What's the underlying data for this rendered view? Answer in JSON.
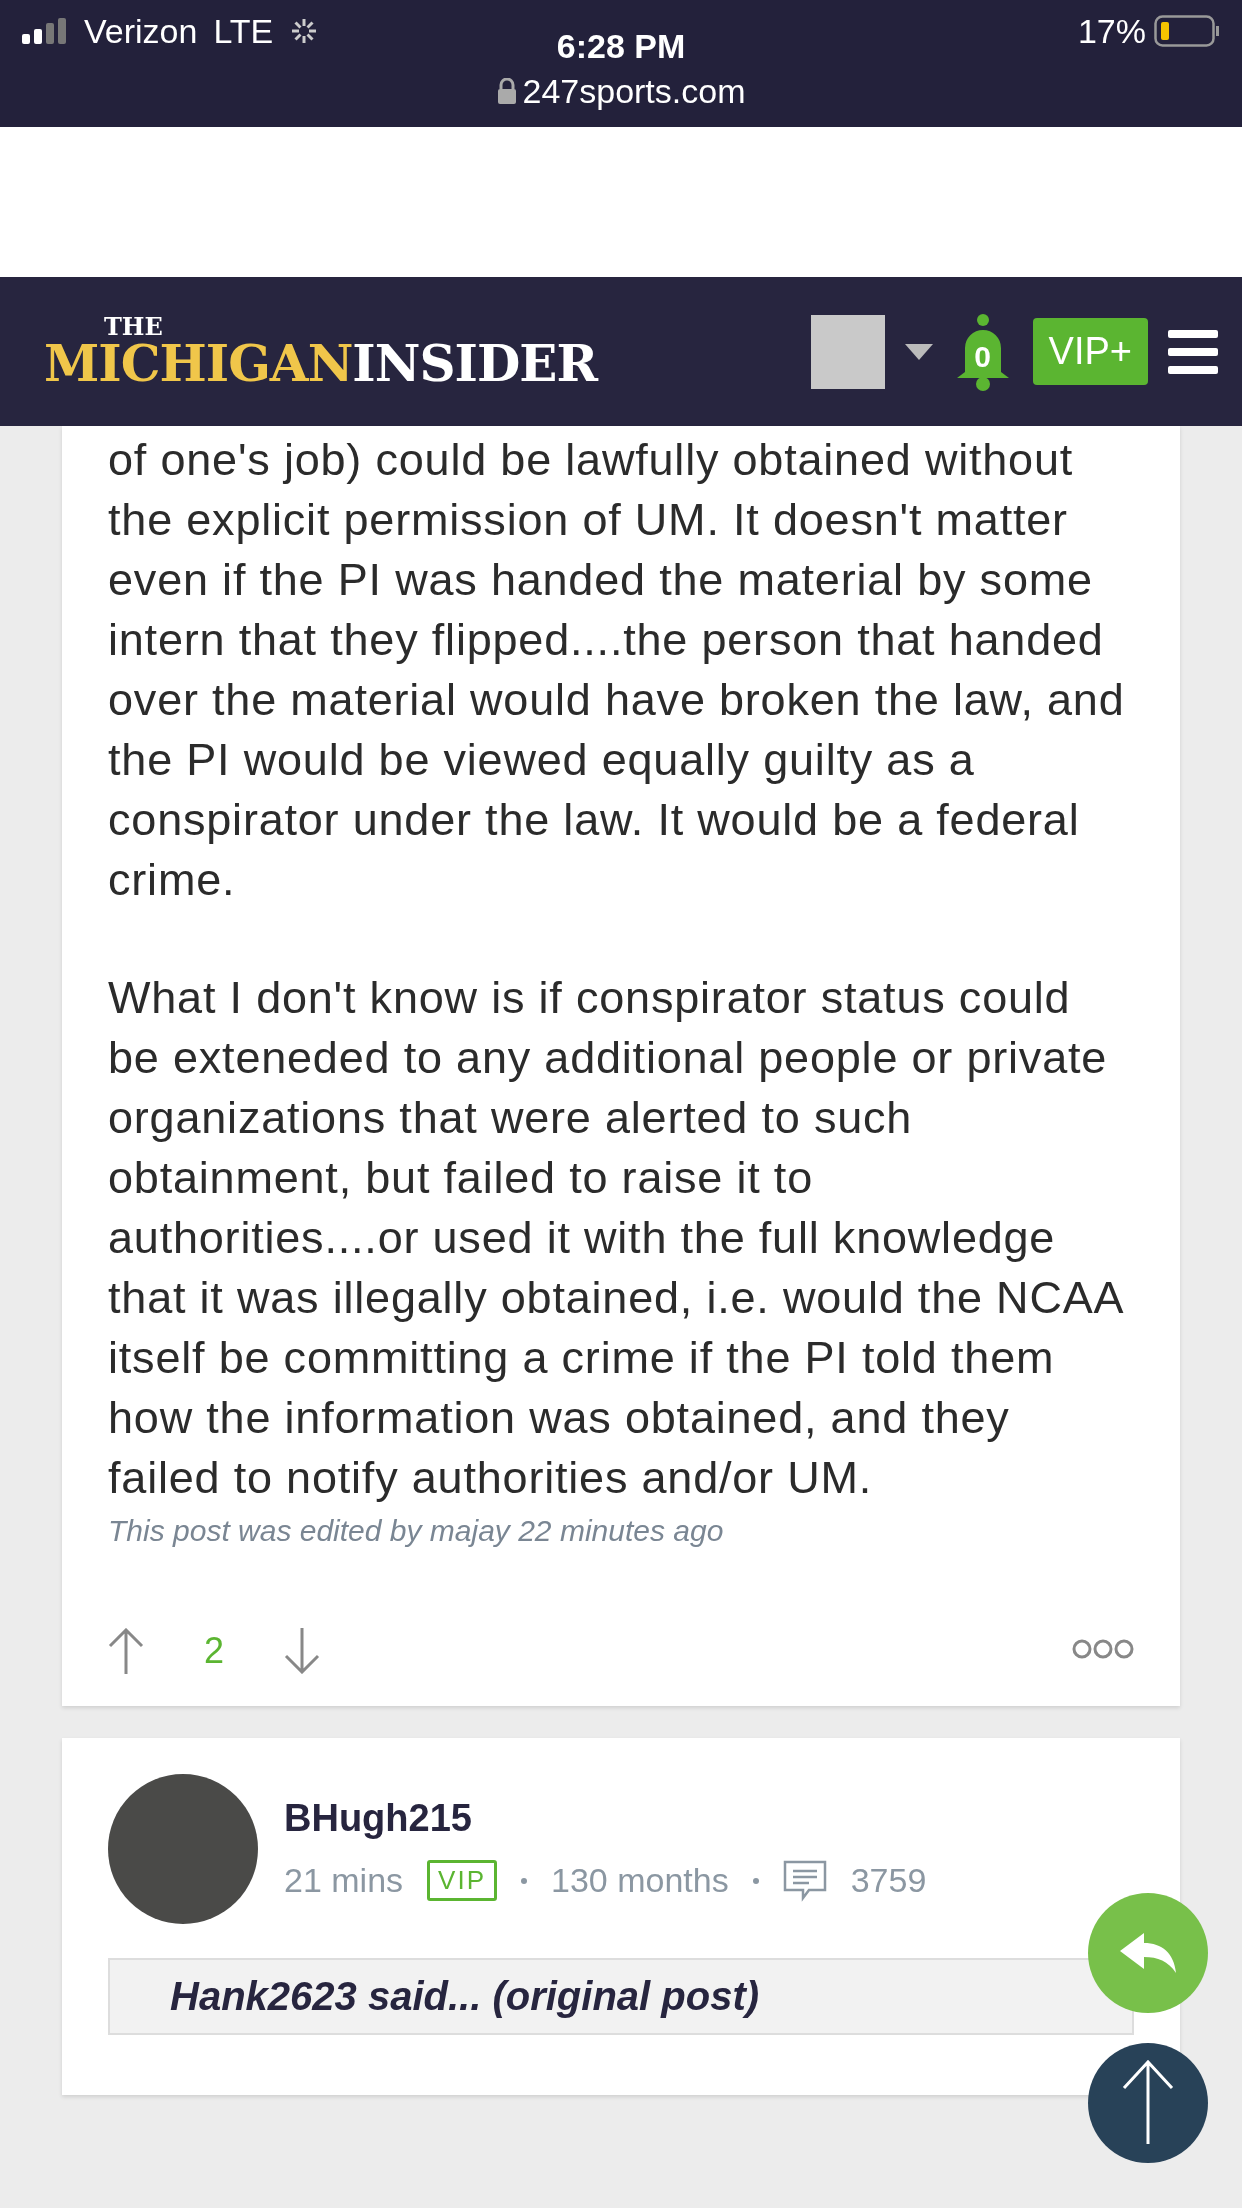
{
  "status_bar": {
    "carrier": "Verizon",
    "network": "LTE",
    "time": "6:28 PM",
    "url": "247sports.com",
    "battery": "17%"
  },
  "site_header": {
    "logo_small": "THE",
    "logo_first": "MICHIGAN",
    "logo_second": "INSIDER",
    "notifications": "0",
    "vip": "VIP+"
  },
  "post": {
    "paragraphs": [
      "of one's job) could be lawfully obtained without the explicit permission of UM. It doesn't matter even if the PI was handed the material by some intern that they flipped....the person that handed over the material would have broken the law, and the PI would be viewed equally guilty as a conspirator under the law. It would be a federal crime.",
      "What I don't know is if conspirator status could be exteneded to any additional people or private organizations that were alerted to such obtainment, but failed to raise it to authorities....or used it with the full knowledge that it was illegally obtained, i.e. would the NCAA itself be committing a crime if the PI told them how the information was obtained, and they failed to notify authorities and/or UM."
    ],
    "edited": "This post was edited by majay 22 minutes ago",
    "votes": "2"
  },
  "next_post": {
    "username": "BHugh215",
    "time": "21 mins",
    "badge": "VIP",
    "tenure": "130 months",
    "post_count": "3759",
    "quote": "Hank2623 said... (original post)"
  }
}
